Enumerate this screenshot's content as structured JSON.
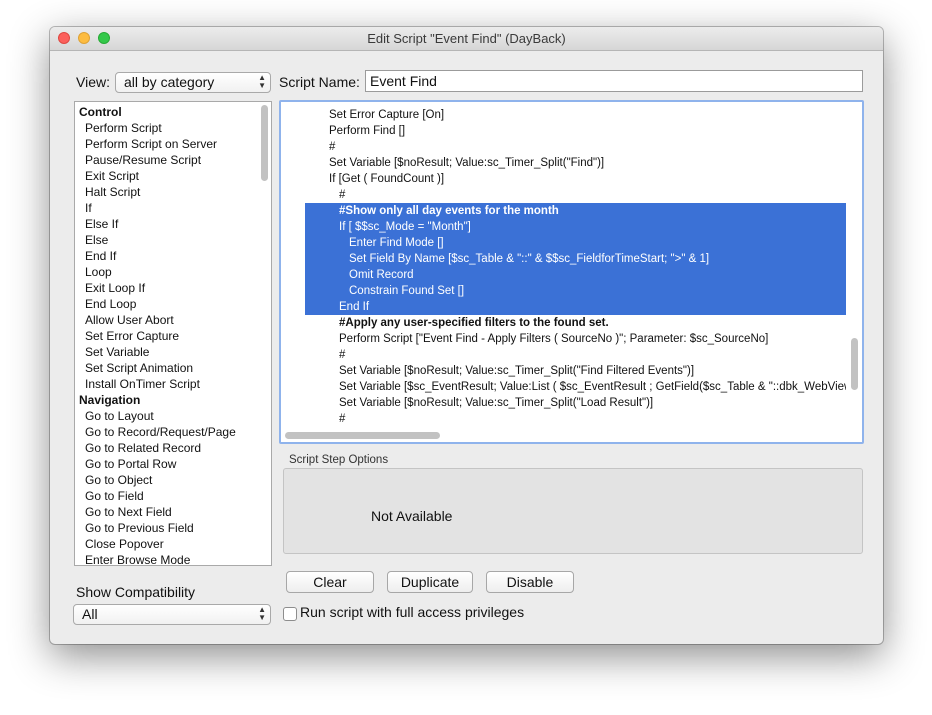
{
  "window": {
    "title": "Edit Script \"Event Find\" (DayBack)"
  },
  "view": {
    "label": "View:",
    "selected": "all by category"
  },
  "script_name": {
    "label": "Script Name:",
    "value": "Event Find"
  },
  "steps": [
    {
      "text": "Control",
      "category": true
    },
    {
      "text": "Perform Script"
    },
    {
      "text": "Perform Script on Server"
    },
    {
      "text": "Pause/Resume Script"
    },
    {
      "text": "Exit Script"
    },
    {
      "text": "Halt Script"
    },
    {
      "text": "If"
    },
    {
      "text": "Else If"
    },
    {
      "text": "Else"
    },
    {
      "text": "End If"
    },
    {
      "text": "Loop"
    },
    {
      "text": "Exit Loop If"
    },
    {
      "text": "End Loop"
    },
    {
      "text": "Allow User Abort"
    },
    {
      "text": "Set Error Capture"
    },
    {
      "text": "Set Variable"
    },
    {
      "text": "Set Script Animation"
    },
    {
      "text": "Install OnTimer Script"
    },
    {
      "text": "Navigation",
      "category": true
    },
    {
      "text": "Go to Layout"
    },
    {
      "text": "Go to Record/Request/Page"
    },
    {
      "text": "Go to Related Record"
    },
    {
      "text": "Go to Portal Row"
    },
    {
      "text": "Go to Object"
    },
    {
      "text": "Go to Field"
    },
    {
      "text": "Go to Next Field"
    },
    {
      "text": "Go to Previous Field"
    },
    {
      "text": "Close Popover"
    },
    {
      "text": "Enter Browse Mode"
    }
  ],
  "script_lines": [
    {
      "text": "Set Error Capture [On]",
      "indent": 1
    },
    {
      "text": "Perform Find []",
      "indent": 1
    },
    {
      "text": "#",
      "indent": 1
    },
    {
      "text": "Set Variable [$noResult; Value:sc_Timer_Split(\"Find\")]",
      "indent": 1
    },
    {
      "text": "If [Get ( FoundCount )]",
      "indent": 1
    },
    {
      "text": "#",
      "indent": 2
    },
    {
      "text": "#Show only all day events for the month",
      "indent": 2,
      "selected": true,
      "bold": true
    },
    {
      "text": "If [ $$sc_Mode = \"Month\"]",
      "indent": 2,
      "selected": true
    },
    {
      "text": "Enter Find Mode []",
      "indent": 3,
      "selected": true
    },
    {
      "text": "Set Field By Name [$sc_Table & \"::\" & $$sc_FieldforTimeStart; \">\" & 1]",
      "indent": 3,
      "selected": true
    },
    {
      "text": "Omit Record",
      "indent": 3,
      "selected": true
    },
    {
      "text": "Constrain Found Set []",
      "indent": 3,
      "selected": true
    },
    {
      "text": "End If",
      "indent": 2,
      "selected": true
    },
    {
      "text": "#Apply any user-specified filters to the found set.",
      "indent": 2,
      "bold": true
    },
    {
      "text": "Perform Script [\"Event Find - Apply Filters ( SourceNo )\"; Parameter: $sc_SourceNo]",
      "indent": 2
    },
    {
      "text": "#",
      "indent": 2
    },
    {
      "text": "Set Variable [$noResult; Value:sc_Timer_Split(\"Find Filtered Events\")]",
      "indent": 2
    },
    {
      "text": "Set Variable [$sc_EventResult; Value:List ( $sc_EventResult ; GetField($sc_Table & \"::dbk_WebViewerSource\" ) )]",
      "indent": 2
    },
    {
      "text": "Set Variable [$noResult; Value:sc_Timer_Split(\"Load Result\")]",
      "indent": 2
    },
    {
      "text": "#",
      "indent": 2
    }
  ],
  "options": {
    "label": "Script Step Options",
    "status": "Not Available"
  },
  "buttons": {
    "clear": "Clear",
    "duplicate": "Duplicate",
    "disable": "Disable"
  },
  "full_access": {
    "label": "Run script with full access privileges",
    "checked": false
  },
  "compatibility": {
    "label": "Show Compatibility",
    "selected": "All"
  },
  "colors": {
    "selection": "#3b71d6",
    "focus_ring": "#8fb3ec"
  }
}
